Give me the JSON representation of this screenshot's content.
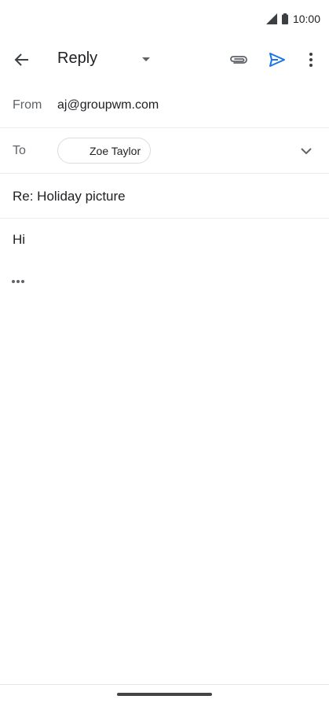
{
  "status_bar": {
    "time": "10:00"
  },
  "app_bar": {
    "title": "Reply"
  },
  "from": {
    "label": "From",
    "value": "aj@groupwm.com"
  },
  "to": {
    "label": "To",
    "recipient": "Zoe Taylor"
  },
  "subject": "Re: Holiday picture",
  "body": "Hi",
  "colors": {
    "send": "#1a73e8",
    "icon": "#5f6368",
    "text": "#202124"
  }
}
